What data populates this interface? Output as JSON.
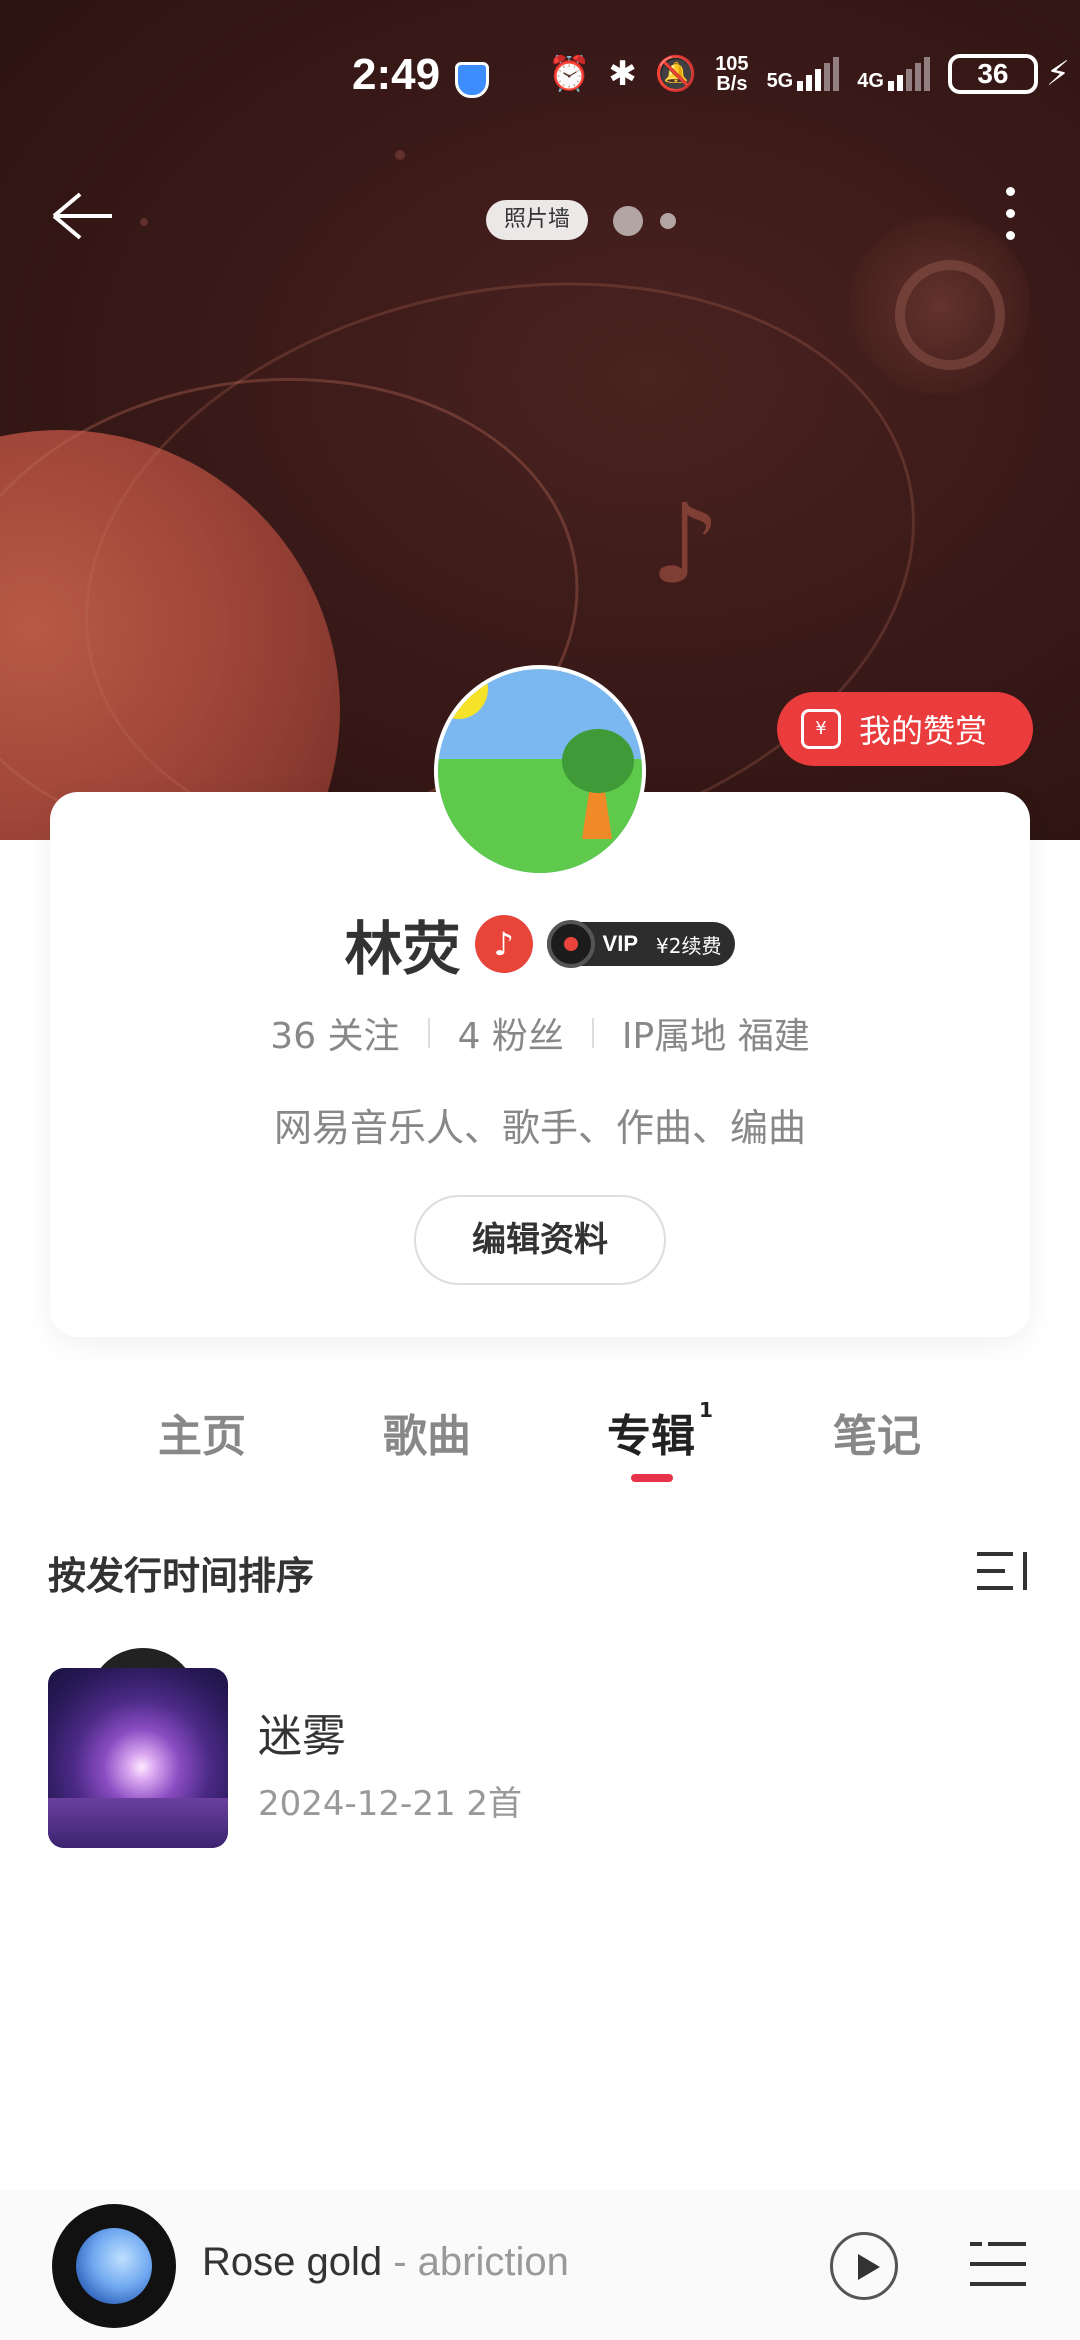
{
  "status_bar": {
    "time": "2:49",
    "net_speed_top": "105",
    "net_speed_bottom": "B/s",
    "sim1": "5G",
    "sim2": "4G",
    "battery": "36"
  },
  "header": {
    "photo_wall_label": "照片墙",
    "reward_label": "我的赞赏",
    "reward_icon": "thumbs-up-yen-icon"
  },
  "profile": {
    "name": "林荧",
    "vip_label": "VIP",
    "vip_renew": "¥2续费",
    "following": "36 关注",
    "followers": "4 粉丝",
    "ip_location": "IP属地 福建",
    "bio": "网易音乐人、歌手、作曲、编曲",
    "edit_label": "编辑资料"
  },
  "tabs": [
    {
      "label": "主页",
      "active": false
    },
    {
      "label": "歌曲",
      "active": false
    },
    {
      "label": "专辑",
      "active": true,
      "badge": "1"
    },
    {
      "label": "笔记",
      "active": false
    }
  ],
  "sort": {
    "label": "按发行时间排序"
  },
  "albums": [
    {
      "title": "迷雾",
      "meta": "2024-12-21 2首"
    }
  ],
  "player": {
    "song": "Rose gold",
    "separator": " - ",
    "artist": "abriction"
  },
  "colors": {
    "accent_red": "#ea3c3c",
    "tab_indicator": "#e8334a",
    "hero_bg": "#3a1a18"
  }
}
